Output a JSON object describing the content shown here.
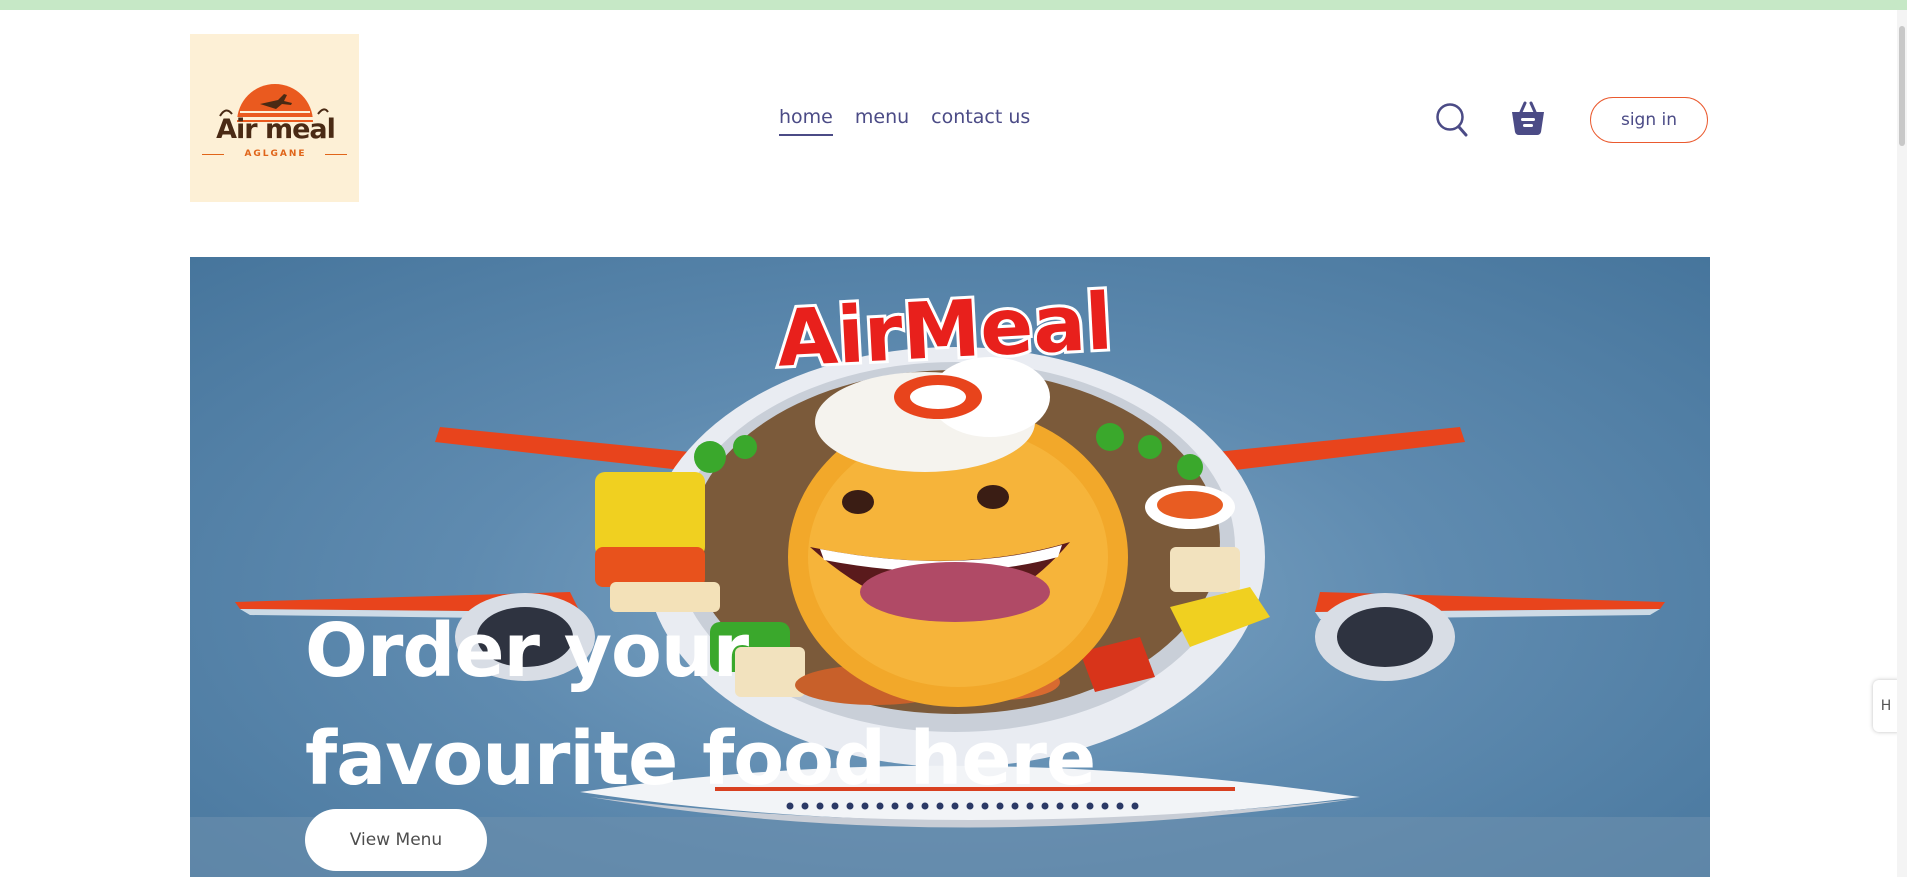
{
  "logo": {
    "name": "Air meal",
    "subtitle": "AGLGANE"
  },
  "nav": {
    "items": [
      {
        "label": "home",
        "active": true
      },
      {
        "label": "menu",
        "active": false
      },
      {
        "label": "contact us",
        "active": false
      }
    ]
  },
  "header": {
    "search_icon": "search-icon",
    "basket_icon": "basket-icon",
    "signin_label": "sign in"
  },
  "hero": {
    "image_brand_text": "AirMeal",
    "title_line1": "Order your",
    "title_line2": "favourite food here",
    "button_label": "View Menu"
  },
  "side_widget": {
    "icon": "h-icon",
    "glyph": "H"
  },
  "colors": {
    "accent": "#ea5a2f",
    "nav_text": "#4b4b86",
    "top_strip": "#c6e8c6",
    "logo_bg": "#fdf0d6",
    "hero_bg": "#5f8bb0"
  }
}
